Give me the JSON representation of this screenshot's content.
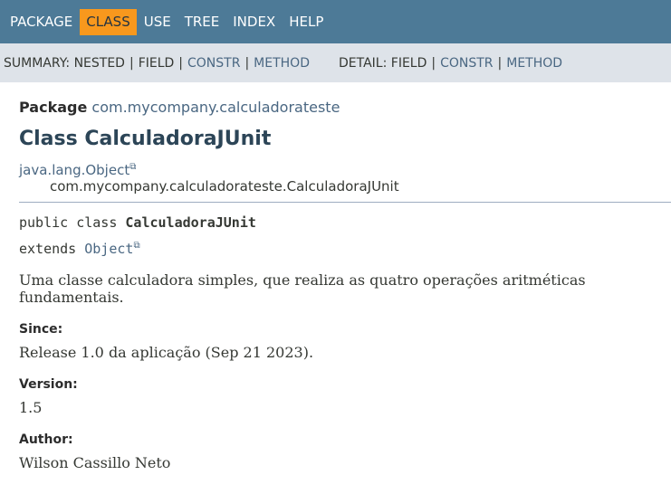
{
  "topnav": {
    "items": [
      "PACKAGE",
      "CLASS",
      "USE",
      "TREE",
      "INDEX",
      "HELP"
    ]
  },
  "subnav": {
    "summary_label": "SUMMARY:",
    "summary_nested": "NESTED",
    "summary_field": "FIELD",
    "summary_constr": "CONSTR",
    "summary_method": "METHOD",
    "detail_label": "DETAIL:",
    "detail_field": "FIELD",
    "detail_constr": "CONSTR",
    "detail_method": "METHOD",
    "separator": "|"
  },
  "header": {
    "package_label": "Package",
    "package_name": "com.mycompany.calculadorateste",
    "class_title": "Class CalculadoraJUnit"
  },
  "inheritance": {
    "parent": "java.lang.Object",
    "child": "com.mycompany.calculadorateste.CalculadoraJUnit"
  },
  "signature": {
    "modifiers": "public class ",
    "class_name": "CalculadoraJUnit",
    "extends_kw": "extends ",
    "extends_type": "Object"
  },
  "description": "Uma classe calculadora simples, que realiza as quatro operações aritméticas fundamentais.",
  "tags": {
    "since_label": "Since:",
    "since_value": "Release 1.0 da aplicação (Sep 21 2023).",
    "version_label": "Version:",
    "version_value": "1.5",
    "author_label": "Author:",
    "author_value": "Wilson Cassillo Neto"
  },
  "icons": {
    "external_link": "external-link-icon"
  },
  "colors": {
    "nav_bg": "#4d7a97",
    "nav_active": "#f8981d",
    "subnav_bg": "#dee3e9",
    "link": "#4a6782"
  }
}
